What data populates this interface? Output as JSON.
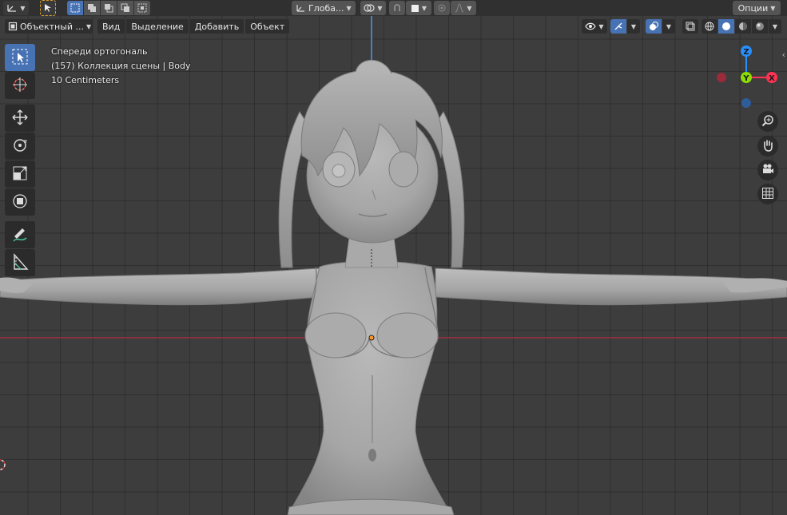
{
  "header": {
    "mode_label": "Объектный ...",
    "menus": [
      "Вид",
      "Выделение",
      "Добавить",
      "Объект"
    ],
    "transform_orientation": "Глоба...",
    "options_label": "Опции"
  },
  "overlay": {
    "view_name": "Спереди ортогональ",
    "collection_info": "(157) Коллекция сцены | Body",
    "grid_scale": "10 Centimeters"
  },
  "gizmo": {
    "x_label": "X",
    "y_label": "Y",
    "z_label": "Z",
    "colors": {
      "x": "#ff3352",
      "y": "#8bdc00",
      "z": "#2890ff"
    }
  },
  "theme": {
    "accent": "#4772b3",
    "x_axis_line": "#b03040",
    "origin_dot": "#ff9a20"
  },
  "toolbar": {
    "tools": [
      "select-box-icon",
      "cursor-icon",
      "move-icon",
      "rotate-icon",
      "scale-icon",
      "transform-icon",
      "annotate-icon",
      "measure-icon"
    ]
  }
}
